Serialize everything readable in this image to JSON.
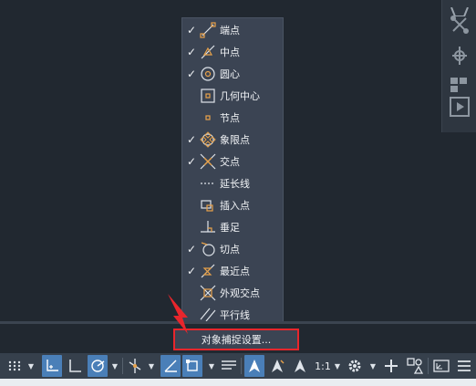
{
  "osnap_menu": {
    "items": [
      {
        "label": "端点",
        "checked": true,
        "icon": "endpoint-icon"
      },
      {
        "label": "中点",
        "checked": true,
        "icon": "midpoint-icon"
      },
      {
        "label": "圆心",
        "checked": true,
        "icon": "center-icon"
      },
      {
        "label": "几何中心",
        "checked": false,
        "icon": "geometric-center-icon"
      },
      {
        "label": "节点",
        "checked": false,
        "icon": "node-icon"
      },
      {
        "label": "象限点",
        "checked": true,
        "icon": "quadrant-icon"
      },
      {
        "label": "交点",
        "checked": true,
        "icon": "intersection-icon"
      },
      {
        "label": "延长线",
        "checked": false,
        "icon": "extension-icon"
      },
      {
        "label": "插入点",
        "checked": false,
        "icon": "insertion-icon"
      },
      {
        "label": "垂足",
        "checked": false,
        "icon": "perpendicular-icon"
      },
      {
        "label": "切点",
        "checked": true,
        "icon": "tangent-icon"
      },
      {
        "label": "最近点",
        "checked": true,
        "icon": "nearest-icon"
      },
      {
        "label": "外观交点",
        "checked": false,
        "icon": "apparent-intersection-icon"
      },
      {
        "label": "平行线",
        "checked": false,
        "icon": "parallel-icon"
      }
    ],
    "check_mark": "✓",
    "settings_label": "对象捕捉设置..."
  },
  "status_bar": {
    "annotation_scale": "1:1"
  },
  "colors": {
    "highlight_box": "#e8262c",
    "snap_icon": "#e8a24a",
    "active_button": "#4a7fb8"
  }
}
